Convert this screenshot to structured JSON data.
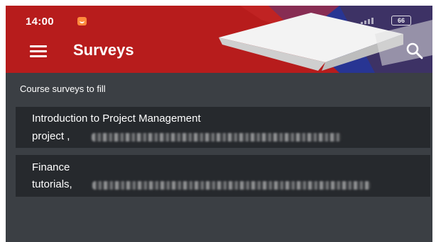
{
  "status_bar": {
    "time": "14:00",
    "battery_level": "66",
    "app_icon": "orange-app-icon"
  },
  "header": {
    "title": "Surveys",
    "menu_icon": "hamburger-menu-icon",
    "search_icon": "search-icon",
    "background_color": "#b71c1c"
  },
  "content": {
    "section_title": "Course surveys to fill",
    "surveys": [
      {
        "line1": "Introduction to Project  Management",
        "line2": "project ,"
      },
      {
        "line1": "Finance",
        "line2": "tutorials,"
      }
    ]
  },
  "colors": {
    "screen_background": "#3b3f44",
    "card_background": "#26292d",
    "text": "#ffffff"
  }
}
